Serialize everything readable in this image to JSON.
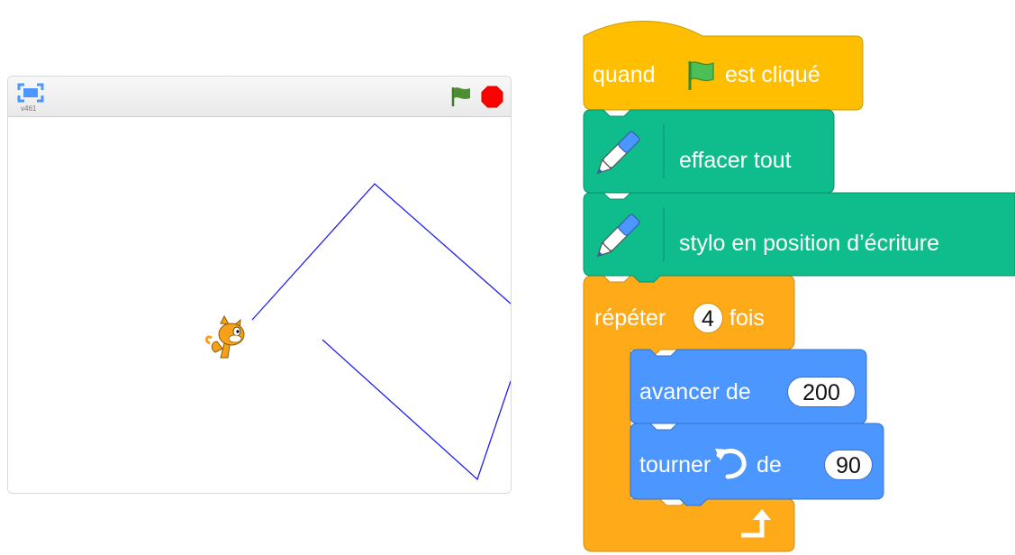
{
  "stage": {
    "version_label": "v461",
    "icons": {
      "fullscreen": "fullscreen-icon",
      "green_flag": "green-flag-icon",
      "stop": "stop-icon",
      "sprite": "cat-sprite"
    },
    "pen_color": "#1a1aff"
  },
  "script": {
    "event_block": {
      "prefix": "quand",
      "suffix": "est cliqué",
      "color": "#ffbf00"
    },
    "pen_clear": {
      "label": "effacer tout",
      "color": "#0fbd8c"
    },
    "pen_down": {
      "label": "stylo en position d’écriture",
      "color": "#0fbd8c"
    },
    "repeat": {
      "prefix": "répéter",
      "count": "4",
      "suffix": "fois",
      "color": "#ffab19"
    },
    "move": {
      "label": "avancer de",
      "value": "200",
      "color": "#4c97ff"
    },
    "turn": {
      "prefix": "tourner",
      "suffix": "de",
      "value": "90",
      "color": "#4c97ff"
    }
  }
}
